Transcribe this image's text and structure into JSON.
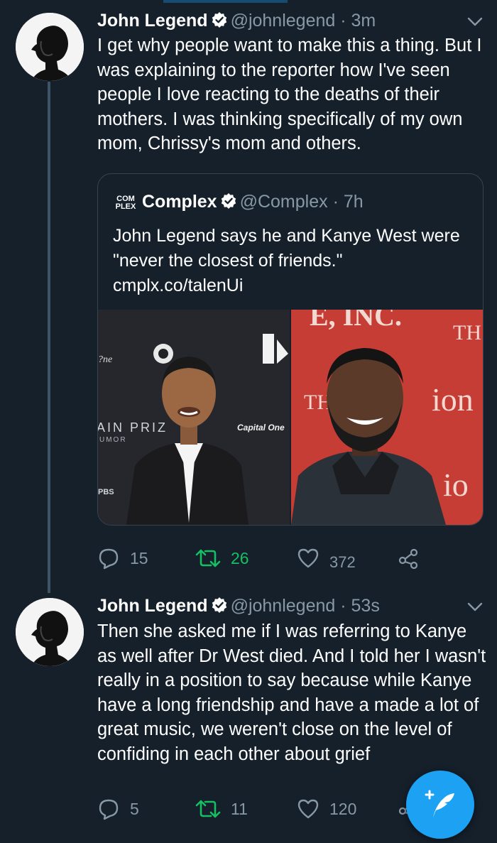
{
  "colors": {
    "background": "#15202b",
    "accent": "#1da1f2",
    "retweet": "#17bf63",
    "muted": "#8899a6"
  },
  "tweets": [
    {
      "name": "John Legend",
      "handle": "@johnlegend",
      "time": "· 3m",
      "text": "I get why people want to make this a thing. But I was explaining to the reporter how I've seen people I love reacting to the deaths of their mothers.  I was thinking specifically of my own mom, Chrissy's mom and others.",
      "quote": {
        "logo": "COM\nPLEX",
        "name": "Complex",
        "handle": "@Complex",
        "time": "· 7h",
        "text": "John Legend says he and Kanye West were \"never the closest of friends.\"",
        "link": "cmplx.co/talenUi",
        "image_text": {
          "left_banner": "AIN PRIZ",
          "left_sub": "UMOR",
          "left_pbs": "PBS",
          "left_capital": "Capital One",
          "right_top": "E, INC.",
          "right_th1": "TH",
          "right_th2": "TH",
          "right_ion": "ion",
          "right_io": "io"
        }
      },
      "actions": {
        "replies": "15",
        "retweets": "26",
        "likes": "372"
      }
    },
    {
      "name": "John Legend",
      "handle": "@johnlegend",
      "time": "· 53s",
      "text": "Then she asked me if I was referring to Kanye as well after Dr West died. And I told her I wasn't really in a position to say because while Kanye have a long friendship and have a made a lot of great music, we weren't close on the level of confiding in each other about grief",
      "actions": {
        "replies": "5",
        "retweets": "11",
        "likes": "120"
      }
    }
  ],
  "icons": {
    "verified": "verified-badge-icon",
    "chevron": "chevron-down-icon",
    "reply": "reply-icon",
    "retweet": "retweet-icon",
    "like": "heart-icon",
    "share": "share-icon",
    "compose": "compose-tweet-icon"
  }
}
